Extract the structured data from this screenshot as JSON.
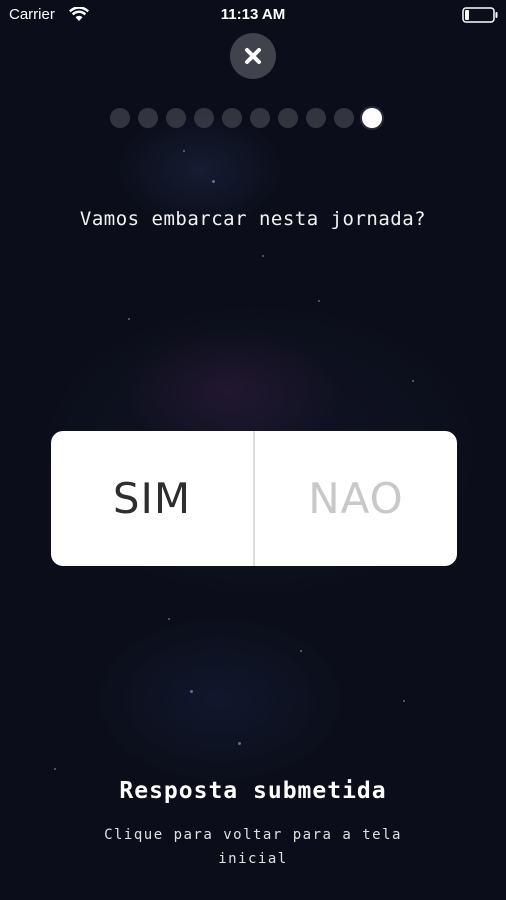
{
  "status_bar": {
    "carrier": "Carrier",
    "time": "11:13 AM",
    "wifi_icon": "wifi-icon",
    "battery_icon": "battery-icon"
  },
  "close_icon": "close-icon",
  "progress": {
    "total_steps": 10,
    "current_step": 10
  },
  "question": "Vamos embarcar nesta jornada?",
  "choices": {
    "yes_label": "SIM",
    "no_label": "NAO",
    "selected": "SIM"
  },
  "footer": {
    "title": "Resposta submetida",
    "subtitle": "Clique para voltar para a tela inicial"
  },
  "colors": {
    "background": "#0b0e1a",
    "card": "#ffffff",
    "selected_text": "#2e2e2e",
    "unselected_text": "#c8c8c8"
  }
}
